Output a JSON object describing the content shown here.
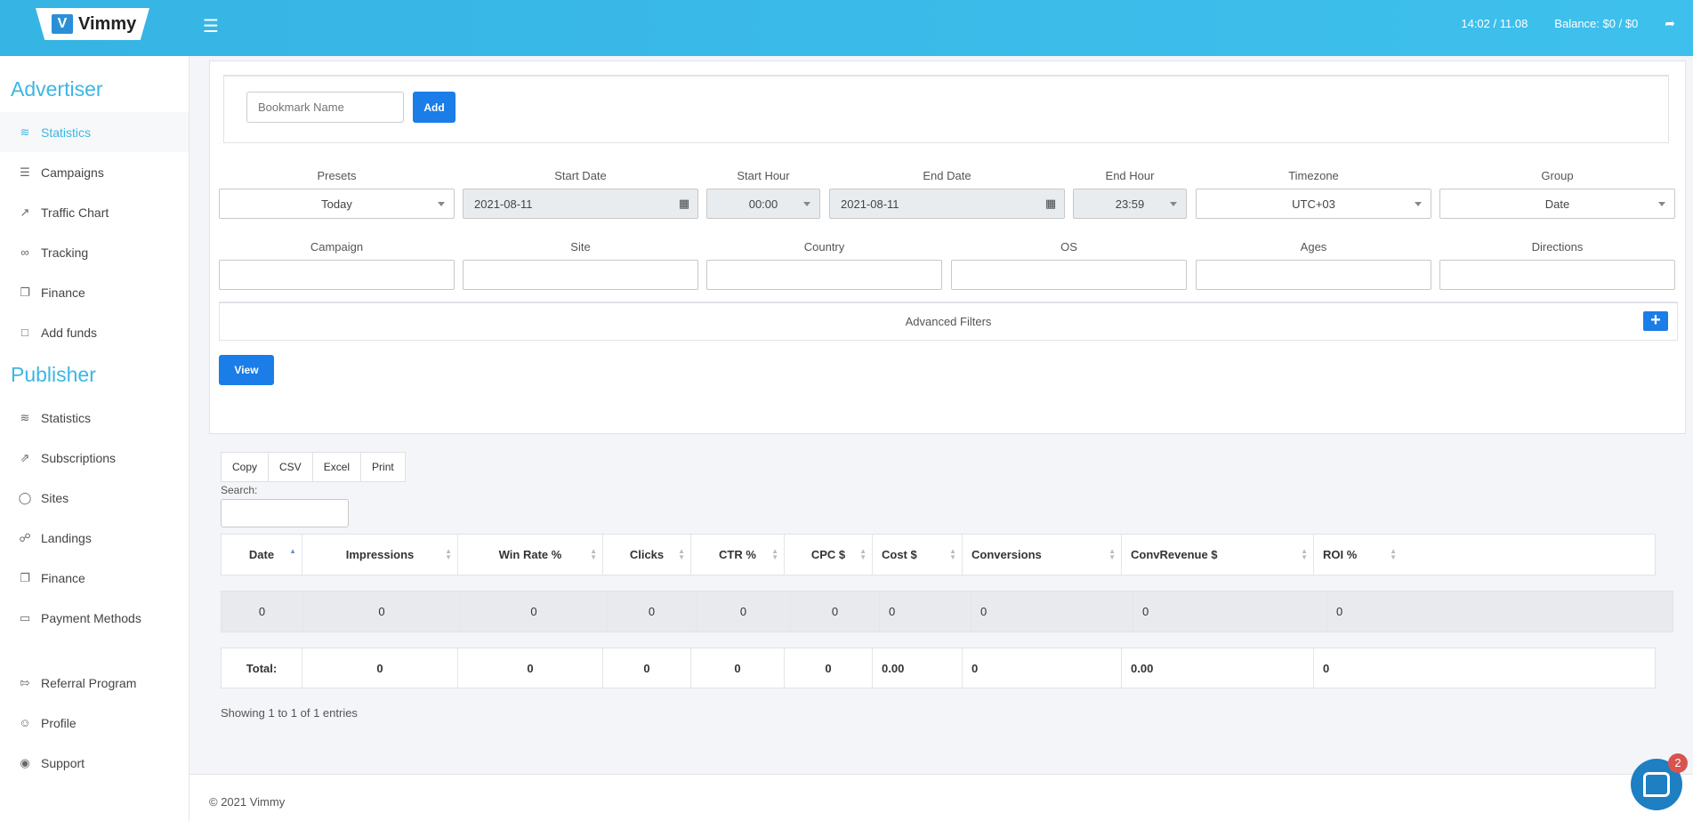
{
  "header": {
    "logo_mark": "V",
    "logo_text": "Vimmy",
    "time": "14:02 / 11.08",
    "balance": "Balance: $0 / $0"
  },
  "sidebar": {
    "advertiser_title": "Advertiser",
    "advertiser_items": [
      {
        "label": "Statistics",
        "icon": "rss-icon",
        "active": true
      },
      {
        "label": "Campaigns",
        "icon": "layers-icon"
      },
      {
        "label": "Traffic Chart",
        "icon": "chart-line-icon"
      },
      {
        "label": "Tracking",
        "icon": "glasses-icon"
      },
      {
        "label": "Finance",
        "icon": "documents-icon"
      },
      {
        "label": "Add funds",
        "icon": "folder-icon"
      }
    ],
    "publisher_title": "Publisher",
    "publisher_items": [
      {
        "label": "Statistics",
        "icon": "rss-icon"
      },
      {
        "label": "Subscriptions",
        "icon": "external-link-icon"
      },
      {
        "label": "Sites",
        "icon": "globe-icon"
      },
      {
        "label": "Landings",
        "icon": "link-icon"
      },
      {
        "label": "Finance",
        "icon": "documents-icon"
      },
      {
        "label": "Payment Methods",
        "icon": "credit-card-icon"
      }
    ],
    "bottom_items": [
      {
        "label": "Referral Program",
        "icon": "sign-in-icon"
      },
      {
        "label": "Profile",
        "icon": "user-icon"
      },
      {
        "label": "Support",
        "icon": "lifebuoy-icon"
      }
    ]
  },
  "bookmark": {
    "placeholder": "Bookmark Name",
    "add_label": "Add"
  },
  "filters": {
    "presets_label": "Presets",
    "presets_value": "Today",
    "start_date_label": "Start Date",
    "start_date_value": "2021-08-11",
    "start_hour_label": "Start Hour",
    "start_hour_value": "00:00",
    "end_date_label": "End Date",
    "end_date_value": "2021-08-11",
    "end_hour_label": "End Hour",
    "end_hour_value": "23:59",
    "timezone_label": "Timezone",
    "timezone_value": "UTC+03",
    "group_label": "Group",
    "group_value": "Date",
    "campaign_label": "Campaign",
    "site_label": "Site",
    "country_label": "Country",
    "os_label": "OS",
    "ages_label": "Ages",
    "directions_label": "Directions",
    "advanced_label": "Advanced Filters",
    "advanced_plus": "+",
    "view_label": "View"
  },
  "export": {
    "copy": "Copy",
    "csv": "CSV",
    "excel": "Excel",
    "print": "Print"
  },
  "search_label": "Search:",
  "table": {
    "columns": [
      "Date",
      "Impressions",
      "Win Rate %",
      "Clicks",
      "CTR %",
      "CPC $",
      "Cost $",
      "Conversions",
      "ConvRevenue $",
      "ROI %"
    ],
    "row": [
      "0",
      "0",
      "0",
      "0",
      "0",
      "0",
      "0",
      "0",
      "0",
      "0"
    ],
    "total": [
      "Total:",
      "0",
      "0",
      "0",
      "0",
      "0",
      "0.00",
      "0",
      "0.00",
      "0"
    ],
    "showing": "Showing 1 to 1 of 1 entries"
  },
  "footer": "© 2021 Vimmy",
  "chat_badge": "2"
}
